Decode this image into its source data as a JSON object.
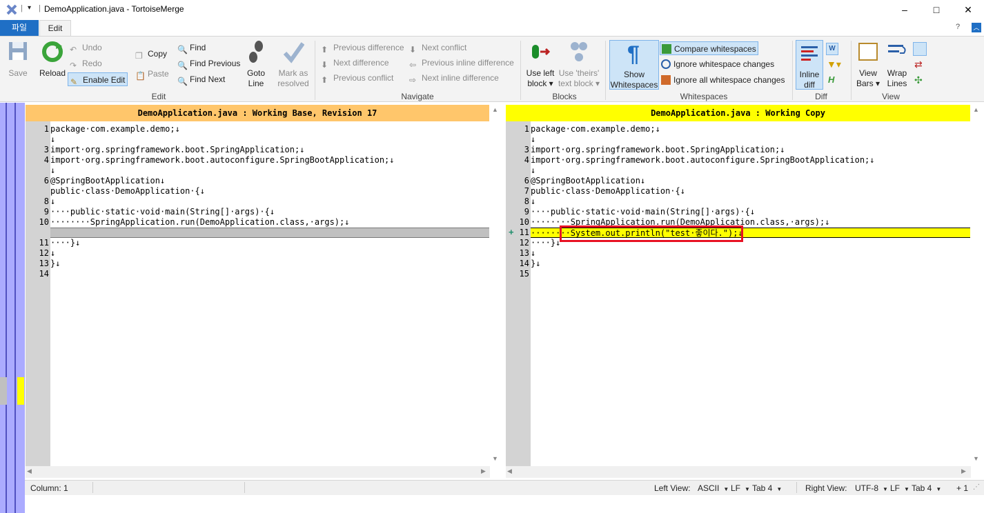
{
  "window": {
    "title": "DemoApplication.java - TortoiseMerge"
  },
  "ribbon_tabs": {
    "file": "파일",
    "edit": "Edit"
  },
  "ribbon": {
    "save": "Save",
    "reload": "Reload",
    "undo": "Undo",
    "redo": "Redo",
    "enable_edit": "Enable Edit",
    "copy": "Copy",
    "paste": "Paste",
    "edit_group": "Edit",
    "find": "Find",
    "find_previous": "Find Previous",
    "find_next": "Find Next",
    "goto_line_1": "Goto",
    "goto_line_2": "Line",
    "mark_resolved_1": "Mark as",
    "mark_resolved_2": "resolved",
    "previous_difference": "Previous difference",
    "next_difference": "Next difference",
    "previous_conflict": "Previous conflict",
    "next_conflict": "Next conflict",
    "previous_inline_difference": "Previous inline difference",
    "next_inline_difference": "Next inline difference",
    "navigate_group": "Navigate",
    "use_left_block_1": "Use left",
    "use_left_block_2": "block ▾",
    "use_theirs_block_1": "Use 'theirs'",
    "use_theirs_block_2": "text block ▾",
    "blocks_group": "Blocks",
    "show_whitespaces_1": "Show",
    "show_whitespaces_2": "Whitespaces",
    "compare_whitespaces": "Compare whitespaces",
    "ignore_whitespace_changes": "Ignore whitespace changes",
    "ignore_all_whitespace_changes": "Ignore all whitespace changes",
    "whitespaces_group": "Whitespaces",
    "inline_diff_1": "Inline",
    "inline_diff_2": "diff",
    "diff_group": "Diff",
    "view_bars_1": "View",
    "view_bars_2": "Bars ▾",
    "wrap_lines_1": "Wrap",
    "wrap_lines_2": "Lines",
    "view_group": "View"
  },
  "left_pane": {
    "header": "DemoApplication.java : Working Base, Revision 17",
    "header_color": "#ffc66b",
    "lines": [
      {
        "num": "1",
        "text": "package·com.example.demo;↓"
      },
      {
        "num": "",
        "text": "↓"
      },
      {
        "num": "3",
        "text": "import·org.springframework.boot.SpringApplication;↓"
      },
      {
        "num": "4",
        "text": "import·org.springframework.boot.autoconfigure.SpringBootApplication;↓"
      },
      {
        "num": "",
        "text": "↓"
      },
      {
        "num": "6",
        "text": "@SpringBootApplication↓"
      },
      {
        "num": "",
        "text": "public·class·DemoApplication·{↓"
      },
      {
        "num": "8",
        "text": "↓"
      },
      {
        "num": "9",
        "text": "····public·static·void·main(String[]·args)·{↓"
      },
      {
        "num": "10",
        "text": "········SpringApplication.run(DemoApplication.class,·args);↓"
      },
      {
        "num": "",
        "text": ""
      },
      {
        "num": "11",
        "text": "····}↓"
      },
      {
        "num": "12",
        "text": "↓"
      },
      {
        "num": "13",
        "text": "}↓"
      },
      {
        "num": "14",
        "text": ""
      }
    ]
  },
  "right_pane": {
    "header": "DemoApplication.java : Working Copy",
    "header_color": "#ffff00",
    "lines": [
      {
        "num": "1",
        "text": "package·com.example.demo;↓"
      },
      {
        "num": "",
        "text": "↓"
      },
      {
        "num": "3",
        "text": "import·org.springframework.boot.SpringApplication;↓"
      },
      {
        "num": "4",
        "text": "import·org.springframework.boot.autoconfigure.SpringBootApplication;↓"
      },
      {
        "num": "",
        "text": "↓"
      },
      {
        "num": "6",
        "text": "@SpringBootApplication↓"
      },
      {
        "num": "7",
        "text": "public·class·DemoApplication·{↓"
      },
      {
        "num": "8",
        "text": "↓"
      },
      {
        "num": "9",
        "text": "····public·static·void·main(String[]·args)·{↓"
      },
      {
        "num": "10",
        "text": "········SpringApplication.run(DemoApplication.class,·args);↓"
      },
      {
        "num": "11",
        "text": "········System.out.println(\"test·좋이다.\");↓"
      },
      {
        "num": "12",
        "text": "····}↓"
      },
      {
        "num": "13",
        "text": "↓"
      },
      {
        "num": "14",
        "text": "}↓"
      },
      {
        "num": "15",
        "text": ""
      }
    ],
    "added_marker": "+"
  },
  "colors": {
    "added_line": "#ffff00",
    "removed_line": "#c0c0c0",
    "highlight_box": "#e81123",
    "location_bar": "#ababff"
  },
  "status": {
    "column": "Column: 1",
    "left_view_label": "Left View:",
    "left_encoding": "ASCII",
    "left_eol": "LF",
    "left_tab": "Tab 4",
    "right_view_label": "Right View:",
    "right_encoding": "UTF-8",
    "right_eol": "LF",
    "right_tab": "Tab 4",
    "diff_count": "+ 1"
  }
}
